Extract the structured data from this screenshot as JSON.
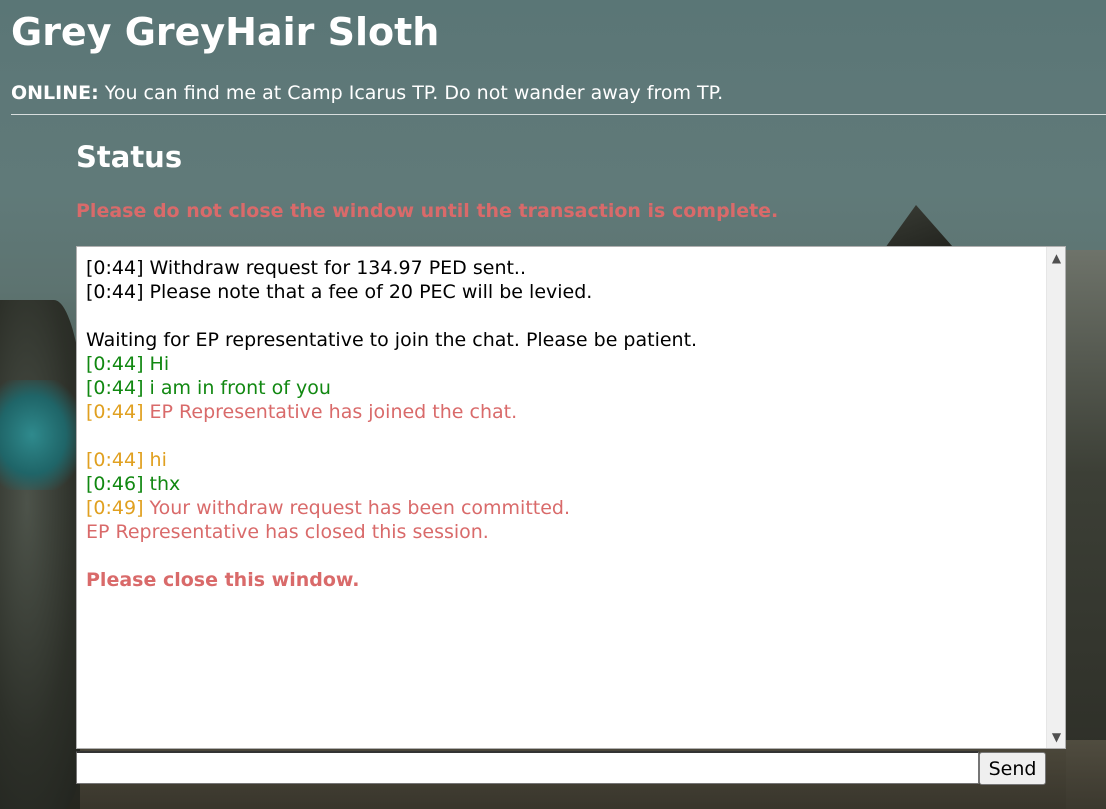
{
  "header": {
    "title": "Grey GreyHair Sloth",
    "online_label": "ONLINE:",
    "online_message": " You can find me at Camp Icarus TP. Do not wander away from TP."
  },
  "status": {
    "heading": "Status",
    "warning": "Please do not close the window until the transaction is complete."
  },
  "chat": {
    "lines": [
      {
        "ts": "[0:44]",
        "text": " Withdraw request for 134.97 PED sent..",
        "ts_color": "black",
        "text_color": "black"
      },
      {
        "ts": "[0:44]",
        "text": " Please note that a fee of 20 PEC will be levied.",
        "ts_color": "black",
        "text_color": "black"
      },
      {
        "blank": true
      },
      {
        "ts": "",
        "text": "Waiting for EP representative to join the chat. Please be patient.",
        "ts_color": "black",
        "text_color": "black"
      },
      {
        "ts": "[0:44]",
        "text": " Hi",
        "ts_color": "green",
        "text_color": "green"
      },
      {
        "ts": "[0:44]",
        "text": " i am in front of you",
        "ts_color": "green",
        "text_color": "green"
      },
      {
        "ts": "[0:44]",
        "text": " EP Representative has joined the chat.",
        "ts_color": "orange",
        "text_color": "red"
      },
      {
        "blank": true
      },
      {
        "ts": "[0:44]",
        "text": " hi",
        "ts_color": "orange",
        "text_color": "orange"
      },
      {
        "ts": "[0:46]",
        "text": " thx",
        "ts_color": "green",
        "text_color": "green"
      },
      {
        "ts": "[0:49]",
        "text": " Your withdraw request has been committed.",
        "ts_color": "orange",
        "text_color": "red"
      },
      {
        "ts": "",
        "text": "EP Representative has closed this session.",
        "ts_color": "red",
        "text_color": "red"
      },
      {
        "blank": true
      },
      {
        "ts": "",
        "text": "Please close this window.",
        "ts_color": "red",
        "text_color": "red",
        "bold": true
      }
    ]
  },
  "input": {
    "value": "",
    "placeholder": ""
  },
  "send_button": {
    "label": "Send"
  },
  "icons": {
    "scroll_up": "chevron-up-icon",
    "scroll_down": "chevron-down-icon"
  },
  "colors": {
    "warning": "#d96a6a",
    "user_green": "#118811",
    "rep_orange": "#e0a020",
    "system_red": "#d96a6a"
  }
}
